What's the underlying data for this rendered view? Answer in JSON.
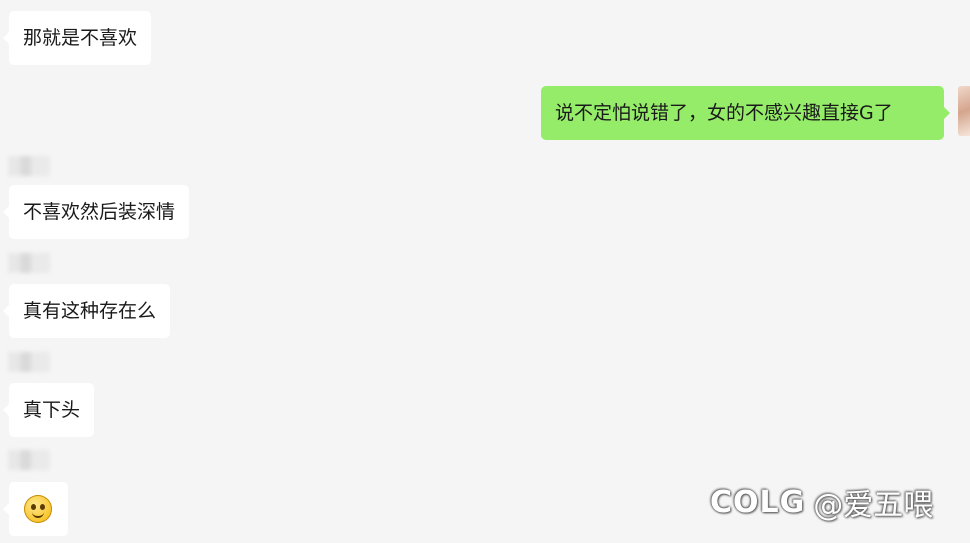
{
  "messages": [
    {
      "side": "left",
      "text": "那就是不喜欢"
    },
    {
      "side": "right",
      "text": "说不定怕说错了，女的不感兴趣直接G了"
    },
    {
      "side": "left",
      "text": "不喜欢然后装深情"
    },
    {
      "side": "left",
      "text": "真有这种存在么"
    },
    {
      "side": "left",
      "text": "真下头"
    },
    {
      "side": "left",
      "emoji": "smiling-face-emoji"
    }
  ],
  "watermark": {
    "logo": "COLG",
    "handle": "@爱五喂"
  }
}
